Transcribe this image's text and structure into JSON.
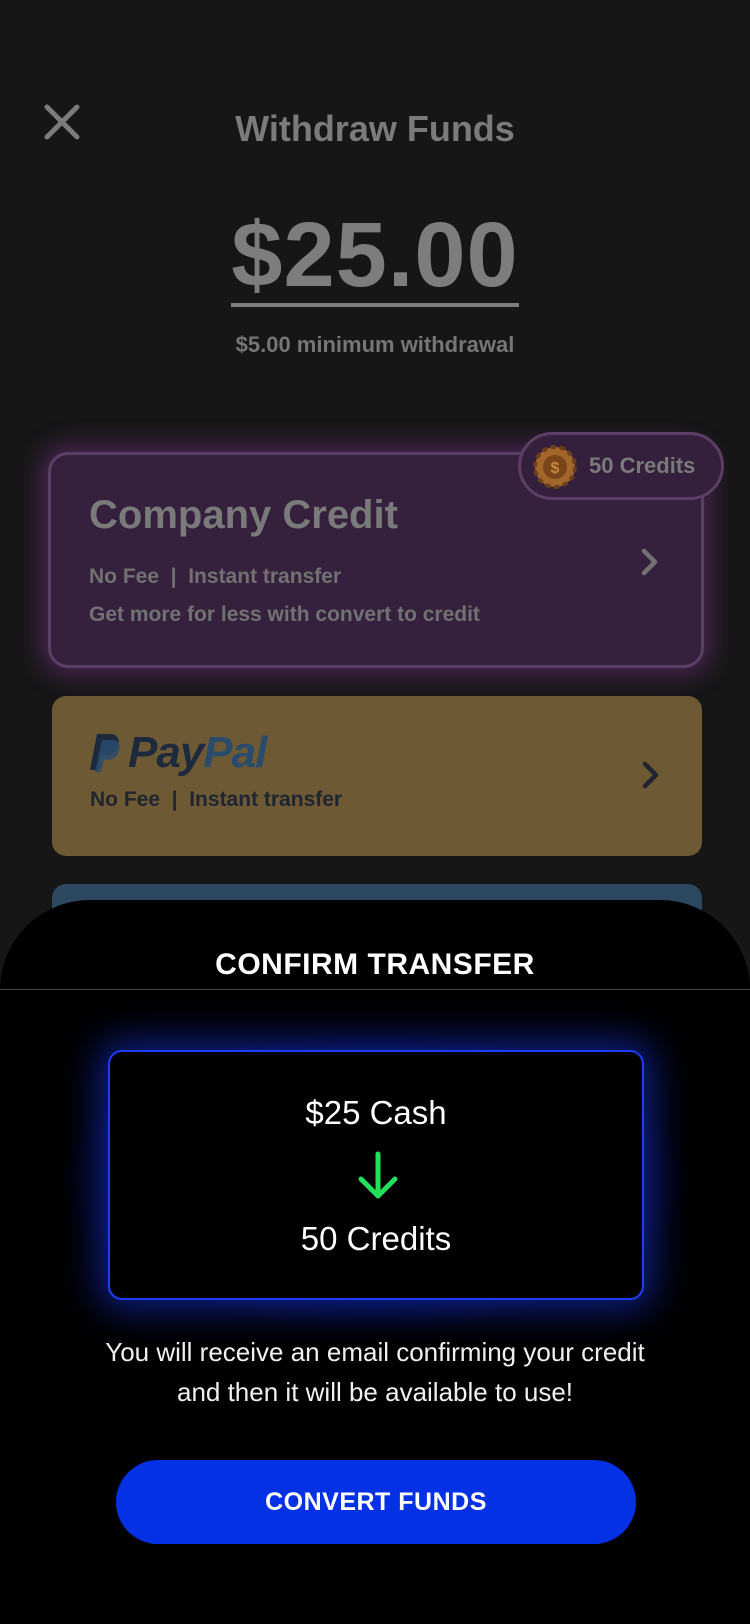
{
  "header": {
    "title": "Withdraw Funds",
    "close_icon": "close-icon"
  },
  "withdraw": {
    "amount": "$25.00",
    "minimum_note": "$5.00 minimum withdrawal"
  },
  "methods": {
    "company_credit": {
      "title": "Company Credit",
      "line1": "No Fee  |  Instant transfer",
      "line2": "Get more for less with convert to credit",
      "badge": "50 Credits",
      "badge_icon": "coin-icon"
    },
    "paypal": {
      "logo_pay": "Pay",
      "logo_pal": "Pal",
      "line1": "No Fee  |  Instant transfer"
    }
  },
  "confirm_sheet": {
    "title": "CONFIRM TRANSFER",
    "from": "$25 Cash",
    "to": "50 Credits",
    "message": "You will receive an email confirming your credit and then it will be available to use!",
    "button": "CONVERT FUNDS"
  },
  "colors": {
    "accent_blue": "#0331e3",
    "arrow_green": "#22e05a",
    "credit_purple": "#35203d",
    "paypal_gold": "#6d5a34"
  }
}
